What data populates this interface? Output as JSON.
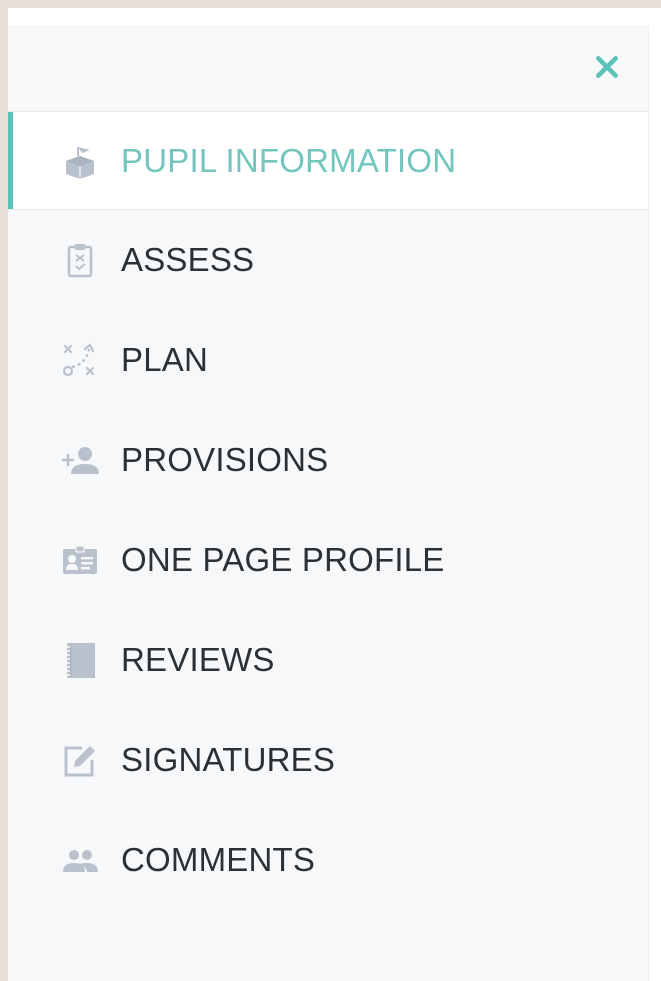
{
  "colors": {
    "accent": "#5cc2b8",
    "active_text": "#73c6be",
    "icon": "#b9c2cc",
    "text": "#2c3136"
  },
  "sidebar": {
    "close_icon": "close-icon",
    "items": [
      {
        "label": "PUPIL INFORMATION",
        "icon": "box-icon",
        "active": true
      },
      {
        "label": "ASSESS",
        "icon": "clipboard-icon",
        "active": false
      },
      {
        "label": "PLAN",
        "icon": "strategy-icon",
        "active": false
      },
      {
        "label": "PROVISIONS",
        "icon": "add-person-icon",
        "active": false
      },
      {
        "label": "ONE PAGE PROFILE",
        "icon": "id-card-icon",
        "active": false
      },
      {
        "label": "REVIEWS",
        "icon": "notebook-icon",
        "active": false
      },
      {
        "label": "SIGNATURES",
        "icon": "edit-icon",
        "active": false
      },
      {
        "label": "COMMENTS",
        "icon": "people-icon",
        "active": false
      }
    ]
  }
}
